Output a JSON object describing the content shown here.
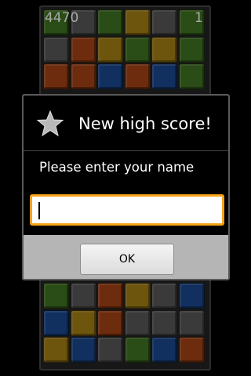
{
  "game": {
    "score": "4470",
    "level": "1",
    "colors": {
      "R": "#c8501a",
      "G": "#4e8a28",
      "B": "#1f58b0",
      "Y": "#c89c1a",
      "K": "#6a6a6a"
    },
    "top_rows": [
      [
        "G",
        "K",
        "G",
        "Y",
        "K",
        "G"
      ],
      [
        "K",
        "R",
        "Y",
        "G",
        "Y",
        "G"
      ],
      [
        "R",
        "R",
        "B",
        "R",
        "B",
        "G"
      ]
    ],
    "bottom_rows": [
      [
        "G",
        "K",
        "R",
        "Y",
        "K",
        "B"
      ],
      [
        "B",
        "Y",
        "R",
        "K",
        "K",
        "K"
      ],
      [
        "Y",
        "B",
        "K",
        "G",
        "B",
        "R"
      ]
    ]
  },
  "dialog": {
    "icon": "star-icon",
    "title": "New high score!",
    "message": "Please enter your name",
    "input_value": "",
    "ok_label": "OK",
    "accent_color": "#f7a319"
  }
}
